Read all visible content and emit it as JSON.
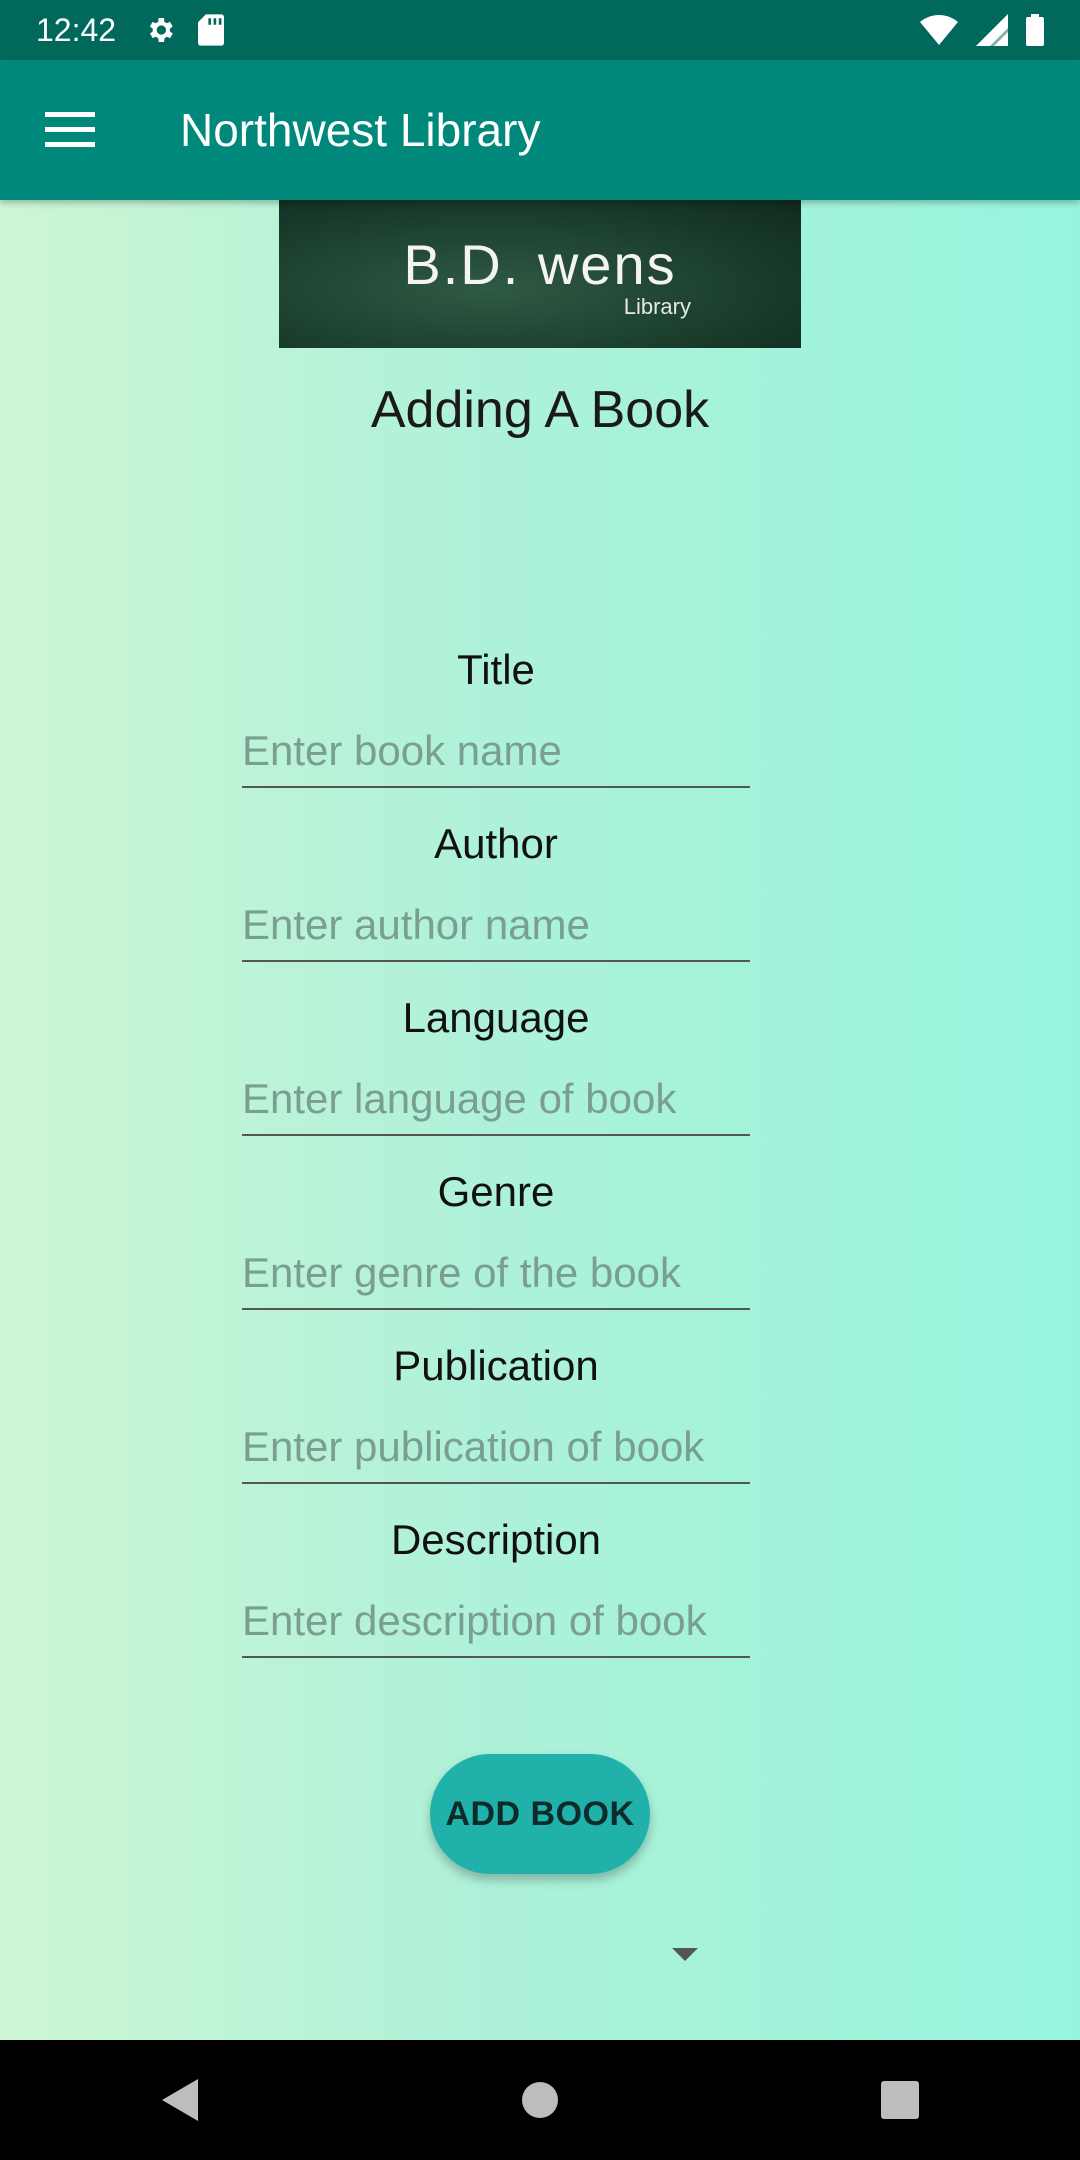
{
  "status_bar": {
    "time": "12:42",
    "icons_left": [
      "gear-icon",
      "sd-card-icon"
    ],
    "icons_right": [
      "wifi-icon",
      "cell-signal-icon",
      "battery-icon"
    ]
  },
  "app_bar": {
    "title": "Northwest Library",
    "menu_icon": "hamburger-menu-icon",
    "background": "#00897b"
  },
  "banner": {
    "logo_text": "B.D. wens",
    "logo_sub": "Library"
  },
  "page": {
    "heading": "Adding A Book"
  },
  "form": {
    "fields": [
      {
        "label": "Title",
        "placeholder": "Enter book name"
      },
      {
        "label": "Author",
        "placeholder": "Enter author name"
      },
      {
        "label": "Language",
        "placeholder": "Enter language of book"
      },
      {
        "label": "Genre",
        "placeholder": "Enter genre of the book"
      },
      {
        "label": "Publication",
        "placeholder": "Enter publication of book"
      },
      {
        "label": "Description",
        "placeholder": "Enter description of book"
      }
    ]
  },
  "actions": {
    "add_label": "ADD BOOK",
    "accent": "#20b2aa"
  },
  "nav_bar": {
    "buttons": [
      "back-icon",
      "home-icon",
      "recents-icon"
    ]
  }
}
